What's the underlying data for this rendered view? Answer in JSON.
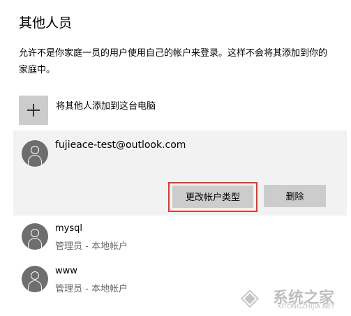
{
  "page": {
    "title": "其他人员",
    "description": "允许不是你家庭一员的用户使用自己的帐户来登录。这样不会将其添加到你的家庭中。"
  },
  "add_other": {
    "label": "将其他人添加到这台电脑",
    "icon": "plus-icon"
  },
  "selected_account": {
    "email": "fujieace-test@outlook.com",
    "change_type_label": "更改帐户类型",
    "delete_label": "删除",
    "highlight_color": "#e8332f"
  },
  "users": [
    {
      "name": "mysql",
      "role": "管理员 - 本地帐户"
    },
    {
      "name": "www",
      "role": "管理员 - 本地帐户"
    }
  ],
  "watermark": {
    "text": "系统之家",
    "url": "XITONGZHIJIA.NET"
  }
}
